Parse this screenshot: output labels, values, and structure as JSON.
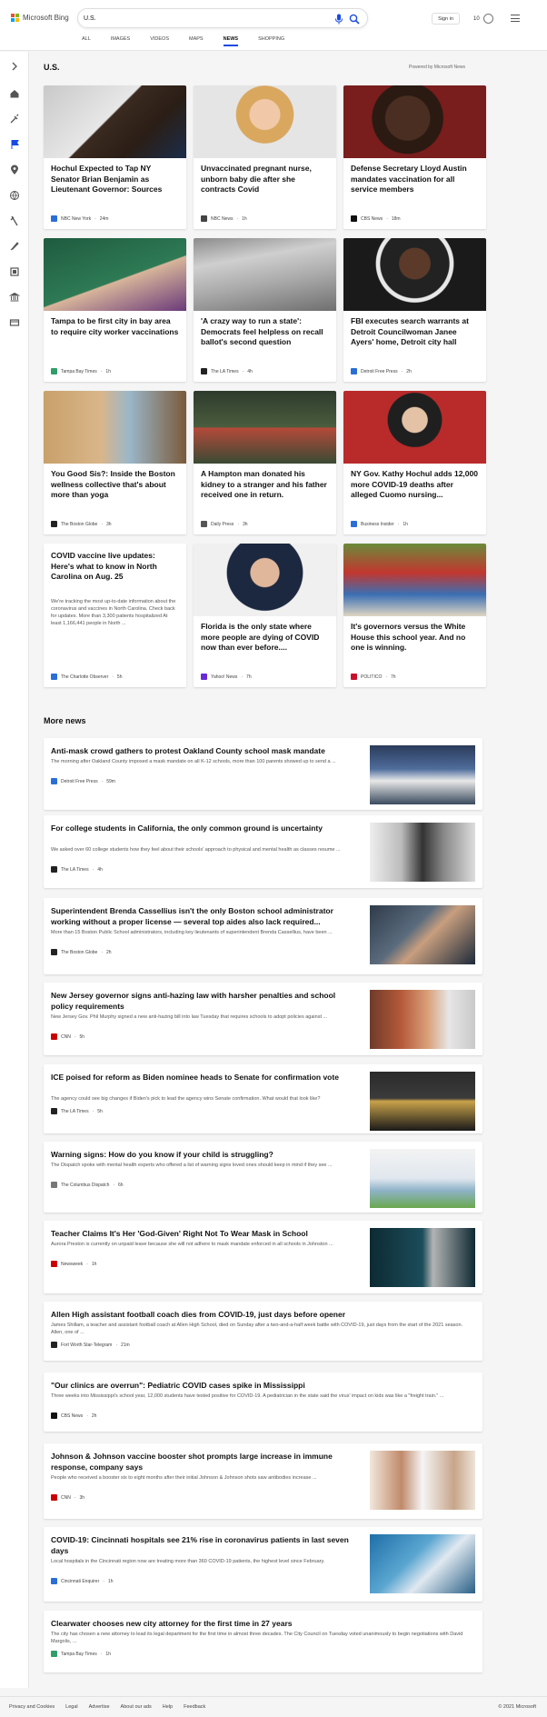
{
  "header": {
    "logo_text": "Microsoft Bing",
    "search_value": "U.S.",
    "signin_label": "Sign in",
    "rewards_count": "10",
    "tabs": [
      {
        "label": "ALL"
      },
      {
        "label": "IMAGES"
      },
      {
        "label": "VIDEOS"
      },
      {
        "label": "MAPS"
      },
      {
        "label": "NEWS",
        "active": true
      },
      {
        "label": "SHOPPING"
      }
    ]
  },
  "left_rail": {
    "icons": [
      "chevron-right-icon",
      "home-icon",
      "tools-icon",
      "flag-icon",
      "location-pin-icon",
      "globe-icon",
      "science-icon",
      "rocket-icon",
      "film-icon",
      "bank-icon",
      "card-icon"
    ]
  },
  "section": {
    "title": "U.S.",
    "powered_by": "Powered by Microsoft News"
  },
  "cards": [
    {
      "headline": "Hochul Expected to Tap NY Senator Brian Benjamin as Lieutenant Governor: Sources",
      "source": "NBC New York",
      "time": "24m",
      "logo_color": "#2a6fd6",
      "image": "portrait-man-suit"
    },
    {
      "headline": "Unvaccinated pregnant nurse, unborn baby die after she contracts Covid",
      "source": "NBC News",
      "time": "1h",
      "logo_color": "#444",
      "image": "portrait-woman-blonde"
    },
    {
      "headline": "Defense Secretary Lloyd Austin mandates vaccination for all service members",
      "source": "CBS News",
      "time": "18m",
      "logo_color": "#111",
      "image": "portrait-man-speaking"
    },
    {
      "headline": "Tampa to be first city in bay area to require city worker vaccinations",
      "source": "Tampa Bay Times",
      "time": "1h",
      "logo_color": "#2f9e6a",
      "image": "woman-green-sign"
    },
    {
      "headline": "'A crazy way to run a state': Democrats feel helpless on recall ballot's second question",
      "source": "The LA Times",
      "time": "4h",
      "logo_color": "#222",
      "image": "ballot"
    },
    {
      "headline": "FBI executes search warrants at Detroit Councilwoman Janee Ayers' home, Detroit city hall",
      "source": "Detroit Free Press",
      "time": "2h",
      "logo_color": "#2a6fd6",
      "image": "woman-polka-dot"
    },
    {
      "headline": "You Good Sis?: Inside the Boston wellness collective that's about more than yoga",
      "source": "The Boston Globe",
      "time": "3h",
      "logo_color": "#222",
      "image": "two-women"
    },
    {
      "headline": "A Hampton man donated his kidney to a stranger and his father received one in return.",
      "source": "Daily Press",
      "time": "3h",
      "logo_color": "#555",
      "image": "two-men-outdoors"
    },
    {
      "headline": "NY Gov. Kathy Hochul adds 12,000 more COVID-19 deaths after alleged Cuomo nursing...",
      "source": "Business Insider",
      "time": "1h",
      "logo_color": "#2a6fd6",
      "image": "woman-podium"
    },
    {
      "headline": "COVID vaccine live updates: Here's what to know in North Carolina on Aug. 25",
      "snippet": "We're tracking the most up-to-date information about the coronavirus and vaccines in North Carolina. Check back for updates. More than 3,300 patients hospitalized At least 1,166,441 people in North ...",
      "source": "The Charlotte Observer",
      "time": "5h",
      "logo_color": "#2a6fd6",
      "image": ""
    },
    {
      "headline": "Florida is the only state where more people are dying of COVID now than ever before....",
      "source": "Yahoo! News",
      "time": "7h",
      "logo_color": "#6a2bd6",
      "image": "man-microphone"
    },
    {
      "headline": "It's governors versus the White House this school year. And no one is winning.",
      "source": "POLITICO",
      "time": "7h",
      "logo_color": "#c8102e",
      "image": "classroom-masks"
    }
  ],
  "more_news": {
    "title": "More news",
    "items": [
      {
        "title": "Anti-mask crowd gathers to protest Oakland County school mask mandate",
        "snippet": "The morning after Oakland County imposed a mask mandate on all K-12 schools, more than 100 parents showed up to send a ...",
        "source": "Detroit Free Press",
        "time": "59m",
        "logo_color": "#2a6fd6",
        "image": "protest"
      },
      {
        "title": "For college students in California, the only common ground is uncertainty",
        "snippet": "We asked over 60 college students how they feel about their schools' approach to physical and mental health as classes resume ...",
        "source": "The LA Times",
        "time": "4h",
        "logo_color": "#222",
        "image": "students-bw"
      },
      {
        "title": "Superintendent Brenda Cassellius isn't the only Boston school administrator working without a proper license — several top aides also lack required...",
        "snippet": "More than 15 Boston Public School administrators, including key lieutenants of superintendent Brenda Cassellius, have been ...",
        "source": "The Boston Globe",
        "time": "2h",
        "logo_color": "#222",
        "image": "woman-office"
      },
      {
        "title": "New Jersey governor signs anti-hazing law with harsher penalties and school policy requirements",
        "snippet": "New Jersey Gov. Phil Murphy signed a new anti-hazing bill into law Tuesday that requires schools to adopt policies against ...",
        "source": "CNN",
        "time": "5h",
        "logo_color": "#cc0000",
        "image": "signing"
      },
      {
        "title": "ICE poised for reform as Biden nominee heads to Senate for confirmation vote",
        "snippet": "The agency could see big changes if Biden's pick to lead the agency wins Senate confirmation. What would that look like?",
        "source": "The LA Times",
        "time": "5h",
        "logo_color": "#222",
        "image": "police-ice"
      },
      {
        "title": "Warning signs: How do you know if your child is struggling?",
        "snippet": "The Dispatch spoke with mental health experts who offered a list of warning signs loved ones should keep in mind if they see ...",
        "source": "The Columbus Dispatch",
        "time": "6h",
        "logo_color": "#777",
        "image": "office-room"
      },
      {
        "title": "Teacher Claims It's Her 'God-Given' Right Not To Wear Mask in School",
        "snippet": "Aurora Preston is currently on unpaid leave because she will not adhere to mask mandate enforced in all schools in Johnston ...",
        "source": "Newsweek",
        "time": "1h",
        "logo_color": "#cc0000",
        "image": "teacher-hallway"
      },
      {
        "title": "Allen High assistant football coach dies from COVID-19, just days before opener",
        "snippet": "James Shillam, a teacher and assistant football coach at Allen High School, died on Sunday after a two-and-a-half week battle with COVID-19, just days from the start of the 2021 season. Allen, one of ...",
        "source": "Fort Worth Star-Telegram",
        "time": "21m",
        "logo_color": "#222",
        "image": ""
      },
      {
        "title": "\"Our clinics are overrun\": Pediatric COVID cases spike in Mississippi",
        "snippet": "Three weeks into Mississippi's school year, 12,000 students have tested positive for COVID-19. A pediatrician in the state said the virus' impact on kids was like a \"freight train.\" ...",
        "source": "CBS News",
        "time": "2h",
        "logo_color": "#111",
        "image": ""
      },
      {
        "title": "Johnson & Johnson vaccine booster shot prompts large increase in immune response, company says",
        "snippet": "People who received a booster six to eight months after their initial Johnson & Johnson shots saw antibodies increase ...",
        "source": "CNN",
        "time": "3h",
        "logo_color": "#cc0000",
        "image": "vials"
      },
      {
        "title": "COVID-19: Cincinnati hospitals see 21% rise in coronavirus patients in last seven days",
        "snippet": "Local hospitals in the Cincinnati region now are treating more than 360 COVID-19 patients, the highest level since February.",
        "source": "Cincinnati Enquirer",
        "time": "1h",
        "logo_color": "#2a6fd6",
        "image": "hospital"
      },
      {
        "title": "Clearwater chooses new city attorney for the first time in 27 years",
        "snippet": "The city has chosen a new attorney to lead its legal department for the first time in almost three decades. The City Council on Tuesday voted unanimously to begin negotiations with David Margolis, ...",
        "source": "Tampa Bay Times",
        "time": "1h",
        "logo_color": "#2f9e6a",
        "image": ""
      }
    ]
  },
  "footer": {
    "links": [
      "Privacy and Cookies",
      "Legal",
      "Advertise",
      "About our ads",
      "Help",
      "Feedback"
    ],
    "copyright": "© 2021 Microsoft"
  }
}
